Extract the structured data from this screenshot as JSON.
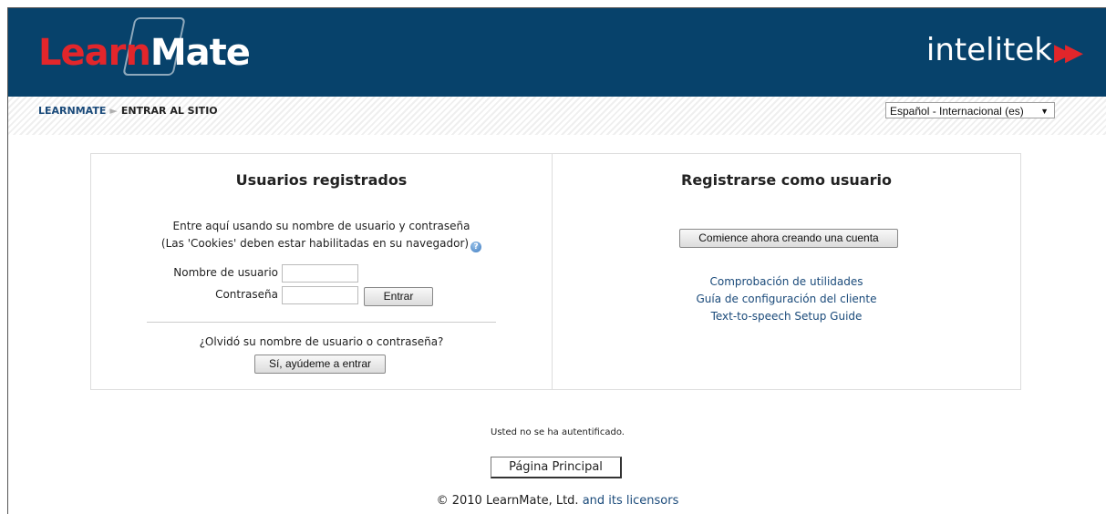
{
  "header": {
    "logo_learn": "Learn",
    "logo_mate": "Mate",
    "brand_right": "intelitek",
    "brand_arrows": "▶▶"
  },
  "breadcrumb": {
    "home": "LEARNMATE",
    "separator": "►",
    "current": "ENTRAR AL SITIO"
  },
  "language_select": {
    "value": "Español - Internacional (es)"
  },
  "login": {
    "title": "Usuarios registrados",
    "desc_line1": "Entre aquí usando su nombre de usuario y contraseña",
    "desc_line2": "(Las 'Cookies' deben estar habilitadas en su navegador)",
    "username_label": "Nombre de usuario",
    "password_label": "Contraseña",
    "username_value": "",
    "password_value": "",
    "submit_label": "Entrar",
    "forgot_text": "¿Olvidó su nombre de usuario o contraseña?",
    "forgot_button": "Sí, ayúdeme a entrar"
  },
  "signup": {
    "title": "Registrarse como usuario",
    "create_button": "Comience ahora creando una cuenta",
    "links": [
      "Comprobación de utilidades",
      "Guía de configuración del cliente",
      "Text-to-speech Setup Guide"
    ]
  },
  "status_text": "Usted no se ha autentificado.",
  "home_button": "Página Principal",
  "footer": {
    "copyright": "© 2010 LearnMate, Ltd.",
    "link": "and its licensors"
  },
  "colors": {
    "header_bg": "#07426b",
    "brand_red": "#e2262b",
    "link": "#1a4a7a"
  }
}
